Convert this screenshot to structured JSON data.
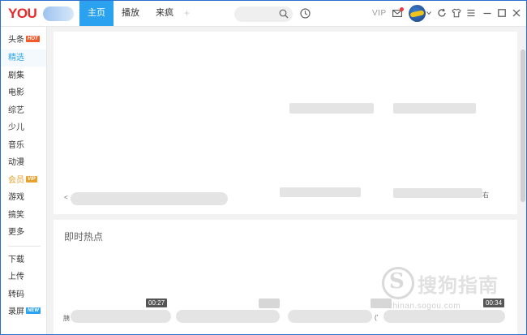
{
  "header": {
    "logo_text": "YOU",
    "tabs": [
      {
        "label": "主页",
        "active": true
      },
      {
        "label": "播放",
        "active": false
      },
      {
        "label": "来疯",
        "active": false
      }
    ],
    "add_tab": "+",
    "vip_label": "VIP"
  },
  "sidebar": {
    "items": [
      {
        "label": "头条",
        "badge": "HOT"
      },
      {
        "label": "精选"
      },
      {
        "label": "剧集"
      },
      {
        "label": "电影"
      },
      {
        "label": "综艺"
      },
      {
        "label": "少儿"
      },
      {
        "label": "音乐"
      },
      {
        "label": "动漫"
      },
      {
        "label": "会员",
        "badge": "VIP"
      },
      {
        "label": "游戏"
      },
      {
        "label": "搞笑"
      },
      {
        "label": "更多"
      }
    ],
    "bottom_items": [
      {
        "label": "下载"
      },
      {
        "label": "上传"
      },
      {
        "label": "转码"
      },
      {
        "label": "录屏",
        "badge": "NEW"
      }
    ]
  },
  "content": {
    "banner_left_text": "<",
    "banner_right_text": "右",
    "hot_section_title": "即时热点",
    "video_durations": [
      "00:27",
      "00:34"
    ],
    "row_left_text": "胰",
    "row_mid_text": "('"
  },
  "watermark": {
    "glyph": "S",
    "text": "搜狗指南",
    "url": "zhinan.sogou.com"
  },
  "colors": {
    "accent": "#2aa2ef",
    "logo_red": "#e62a2a",
    "hot_badge": "#f25a2b",
    "vip_badge": "#e6a12e",
    "new_badge": "#2aa2ef"
  }
}
